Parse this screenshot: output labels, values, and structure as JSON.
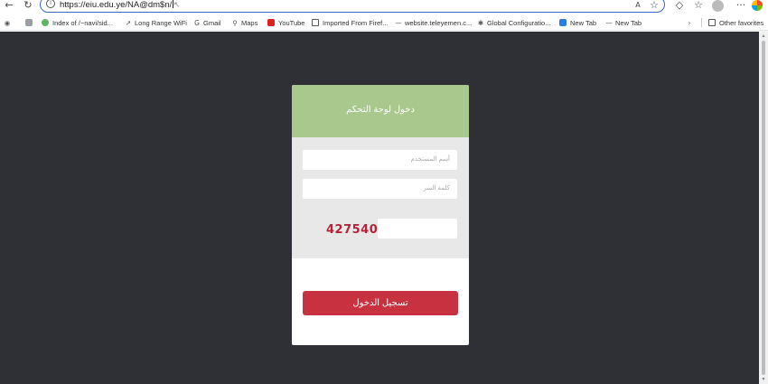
{
  "browser": {
    "url": "https://eiu.edu.ye/NA@dm$n/",
    "favorites": [
      {
        "label": "Index of /~navi/sid...",
        "icon": "green-circle-icon"
      },
      {
        "label": "Long Range WiFi",
        "icon": "wifi-brand-icon"
      },
      {
        "label": "Gmail",
        "icon": "google-icon"
      },
      {
        "label": "Maps",
        "icon": "map-pin-icon"
      },
      {
        "label": "YouTube",
        "icon": "youtube-icon"
      },
      {
        "label": "Imported From Firef...",
        "icon": "folder-icon"
      },
      {
        "label": "website.teleyemen.c...",
        "icon": "dash-icon"
      },
      {
        "label": "Global Configuratio...",
        "icon": "gear-leaf-icon"
      },
      {
        "label": "New Tab",
        "icon": "new-tab-icon"
      },
      {
        "label": "New Tab",
        "icon": "dash-icon"
      }
    ],
    "other_favorites": "Other favorites"
  },
  "login": {
    "title": "دخول لوحة التحكم",
    "username_placeholder": "أسم المستخدم",
    "password_placeholder": "كلمة السر",
    "captcha_code": "427540",
    "submit_label": "تسجيل الدخول"
  },
  "colors": {
    "header": "#a9c88e",
    "submit": "#c8313f",
    "background": "#2f2f36",
    "captcha": "#b5223a"
  }
}
